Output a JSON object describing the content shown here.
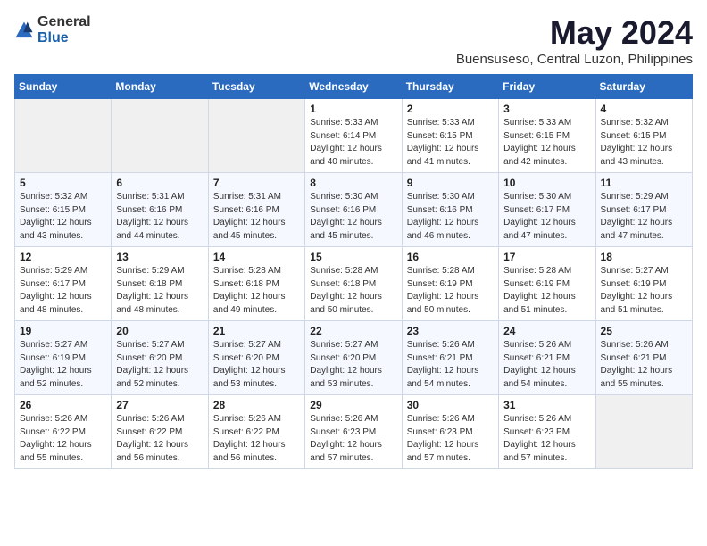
{
  "logo": {
    "text_general": "General",
    "text_blue": "Blue"
  },
  "title": "May 2024",
  "location": "Buensuseso, Central Luzon, Philippines",
  "headers": [
    "Sunday",
    "Monday",
    "Tuesday",
    "Wednesday",
    "Thursday",
    "Friday",
    "Saturday"
  ],
  "weeks": [
    [
      {
        "day": "",
        "info": ""
      },
      {
        "day": "",
        "info": ""
      },
      {
        "day": "",
        "info": ""
      },
      {
        "day": "1",
        "info": "Sunrise: 5:33 AM\nSunset: 6:14 PM\nDaylight: 12 hours\nand 40 minutes."
      },
      {
        "day": "2",
        "info": "Sunrise: 5:33 AM\nSunset: 6:15 PM\nDaylight: 12 hours\nand 41 minutes."
      },
      {
        "day": "3",
        "info": "Sunrise: 5:33 AM\nSunset: 6:15 PM\nDaylight: 12 hours\nand 42 minutes."
      },
      {
        "day": "4",
        "info": "Sunrise: 5:32 AM\nSunset: 6:15 PM\nDaylight: 12 hours\nand 43 minutes."
      }
    ],
    [
      {
        "day": "5",
        "info": "Sunrise: 5:32 AM\nSunset: 6:15 PM\nDaylight: 12 hours\nand 43 minutes."
      },
      {
        "day": "6",
        "info": "Sunrise: 5:31 AM\nSunset: 6:16 PM\nDaylight: 12 hours\nand 44 minutes."
      },
      {
        "day": "7",
        "info": "Sunrise: 5:31 AM\nSunset: 6:16 PM\nDaylight: 12 hours\nand 45 minutes."
      },
      {
        "day": "8",
        "info": "Sunrise: 5:30 AM\nSunset: 6:16 PM\nDaylight: 12 hours\nand 45 minutes."
      },
      {
        "day": "9",
        "info": "Sunrise: 5:30 AM\nSunset: 6:16 PM\nDaylight: 12 hours\nand 46 minutes."
      },
      {
        "day": "10",
        "info": "Sunrise: 5:30 AM\nSunset: 6:17 PM\nDaylight: 12 hours\nand 47 minutes."
      },
      {
        "day": "11",
        "info": "Sunrise: 5:29 AM\nSunset: 6:17 PM\nDaylight: 12 hours\nand 47 minutes."
      }
    ],
    [
      {
        "day": "12",
        "info": "Sunrise: 5:29 AM\nSunset: 6:17 PM\nDaylight: 12 hours\nand 48 minutes."
      },
      {
        "day": "13",
        "info": "Sunrise: 5:29 AM\nSunset: 6:18 PM\nDaylight: 12 hours\nand 48 minutes."
      },
      {
        "day": "14",
        "info": "Sunrise: 5:28 AM\nSunset: 6:18 PM\nDaylight: 12 hours\nand 49 minutes."
      },
      {
        "day": "15",
        "info": "Sunrise: 5:28 AM\nSunset: 6:18 PM\nDaylight: 12 hours\nand 50 minutes."
      },
      {
        "day": "16",
        "info": "Sunrise: 5:28 AM\nSunset: 6:19 PM\nDaylight: 12 hours\nand 50 minutes."
      },
      {
        "day": "17",
        "info": "Sunrise: 5:28 AM\nSunset: 6:19 PM\nDaylight: 12 hours\nand 51 minutes."
      },
      {
        "day": "18",
        "info": "Sunrise: 5:27 AM\nSunset: 6:19 PM\nDaylight: 12 hours\nand 51 minutes."
      }
    ],
    [
      {
        "day": "19",
        "info": "Sunrise: 5:27 AM\nSunset: 6:19 PM\nDaylight: 12 hours\nand 52 minutes."
      },
      {
        "day": "20",
        "info": "Sunrise: 5:27 AM\nSunset: 6:20 PM\nDaylight: 12 hours\nand 52 minutes."
      },
      {
        "day": "21",
        "info": "Sunrise: 5:27 AM\nSunset: 6:20 PM\nDaylight: 12 hours\nand 53 minutes."
      },
      {
        "day": "22",
        "info": "Sunrise: 5:27 AM\nSunset: 6:20 PM\nDaylight: 12 hours\nand 53 minutes."
      },
      {
        "day": "23",
        "info": "Sunrise: 5:26 AM\nSunset: 6:21 PM\nDaylight: 12 hours\nand 54 minutes."
      },
      {
        "day": "24",
        "info": "Sunrise: 5:26 AM\nSunset: 6:21 PM\nDaylight: 12 hours\nand 54 minutes."
      },
      {
        "day": "25",
        "info": "Sunrise: 5:26 AM\nSunset: 6:21 PM\nDaylight: 12 hours\nand 55 minutes."
      }
    ],
    [
      {
        "day": "26",
        "info": "Sunrise: 5:26 AM\nSunset: 6:22 PM\nDaylight: 12 hours\nand 55 minutes."
      },
      {
        "day": "27",
        "info": "Sunrise: 5:26 AM\nSunset: 6:22 PM\nDaylight: 12 hours\nand 56 minutes."
      },
      {
        "day": "28",
        "info": "Sunrise: 5:26 AM\nSunset: 6:22 PM\nDaylight: 12 hours\nand 56 minutes."
      },
      {
        "day": "29",
        "info": "Sunrise: 5:26 AM\nSunset: 6:23 PM\nDaylight: 12 hours\nand 57 minutes."
      },
      {
        "day": "30",
        "info": "Sunrise: 5:26 AM\nSunset: 6:23 PM\nDaylight: 12 hours\nand 57 minutes."
      },
      {
        "day": "31",
        "info": "Sunrise: 5:26 AM\nSunset: 6:23 PM\nDaylight: 12 hours\nand 57 minutes."
      },
      {
        "day": "",
        "info": ""
      }
    ]
  ]
}
